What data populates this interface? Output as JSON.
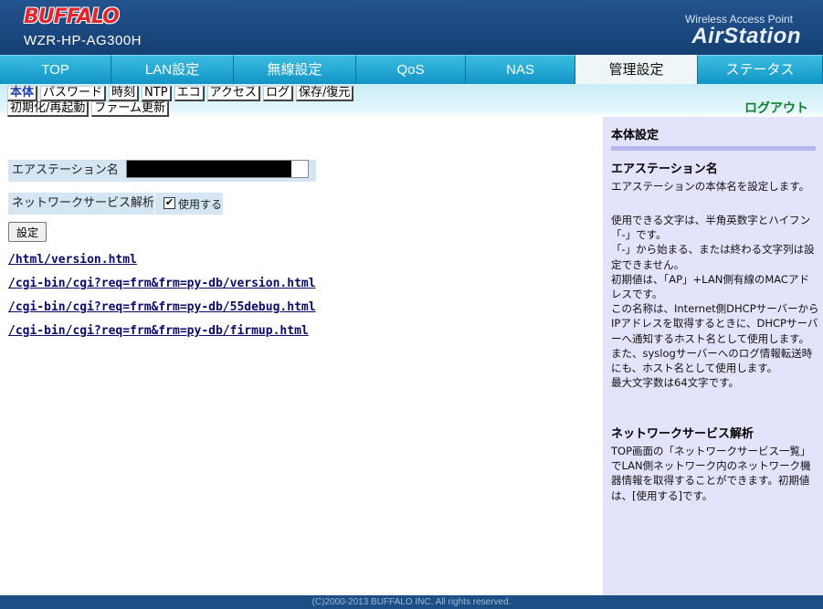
{
  "header": {
    "brand": "BUFFALO",
    "model": "WZR-HP-AG300H",
    "product_line": "Wireless Access Point",
    "product_name": "AirStation"
  },
  "nav": {
    "tabs": [
      "TOP",
      "LAN設定",
      "無線設定",
      "QoS",
      "NAS",
      "管理設定",
      "ステータス"
    ],
    "active": "管理設定"
  },
  "subnav": {
    "row1": [
      "本体",
      "パスワード",
      "時刻",
      "NTP",
      "エコ",
      "アクセス",
      "ログ",
      "保存/復元"
    ],
    "row2": [
      "初期化/再起動",
      "ファーム更新"
    ],
    "active": "本体",
    "logout": "ログアウト"
  },
  "form": {
    "station_name_label": "エアステーション名",
    "station_name_value": "",
    "network_service_label": "ネットワークサービス解析",
    "network_service_checked": true,
    "network_service_option": "使用する",
    "submit_label": "設定"
  },
  "links": [
    "/html/version.html",
    "/cgi-bin/cgi?req=frm&frm=py-db/version.html",
    "/cgi-bin/cgi?req=frm&frm=py-db/55debug.html",
    "/cgi-bin/cgi?req=frm&frm=py-db/firmup.html"
  ],
  "help": {
    "title": "本体設定",
    "section1_title": "エアステーション名",
    "section1_text1": "エアステーションの本体名を設定します。",
    "section1_text2": "使用できる文字は、半角英数字とハイフン「-」です。\n「-」から始まる、または終わる文字列は設定できません。\n初期値は、「AP」+LAN側有線のMACアドレスです。\nこの名称は、Internet側DHCPサーバーからIPアドレスを取得するときに、DHCPサーバーへ通知するホスト名として使用します。\nまた、syslogサーバーへのログ情報転送時にも、ホスト名として使用します。\n最大文字数は64文字です。",
    "section2_title": "ネットワークサービス解析",
    "section2_text": "TOP画面の「ネットワークサービス一覧」でLAN側ネットワーク内のネットワーク機器情報を取得することができます。初期値は、[使用する]です。"
  },
  "footer": "(C)2000-2013 BUFFALO INC. All rights reserved.",
  "colors": {
    "header_bg": "#1b4a80",
    "nav_tab": "#1fa7d4",
    "logout_text": "#0f7f2c",
    "help_bg": "#e3e3fb"
  }
}
